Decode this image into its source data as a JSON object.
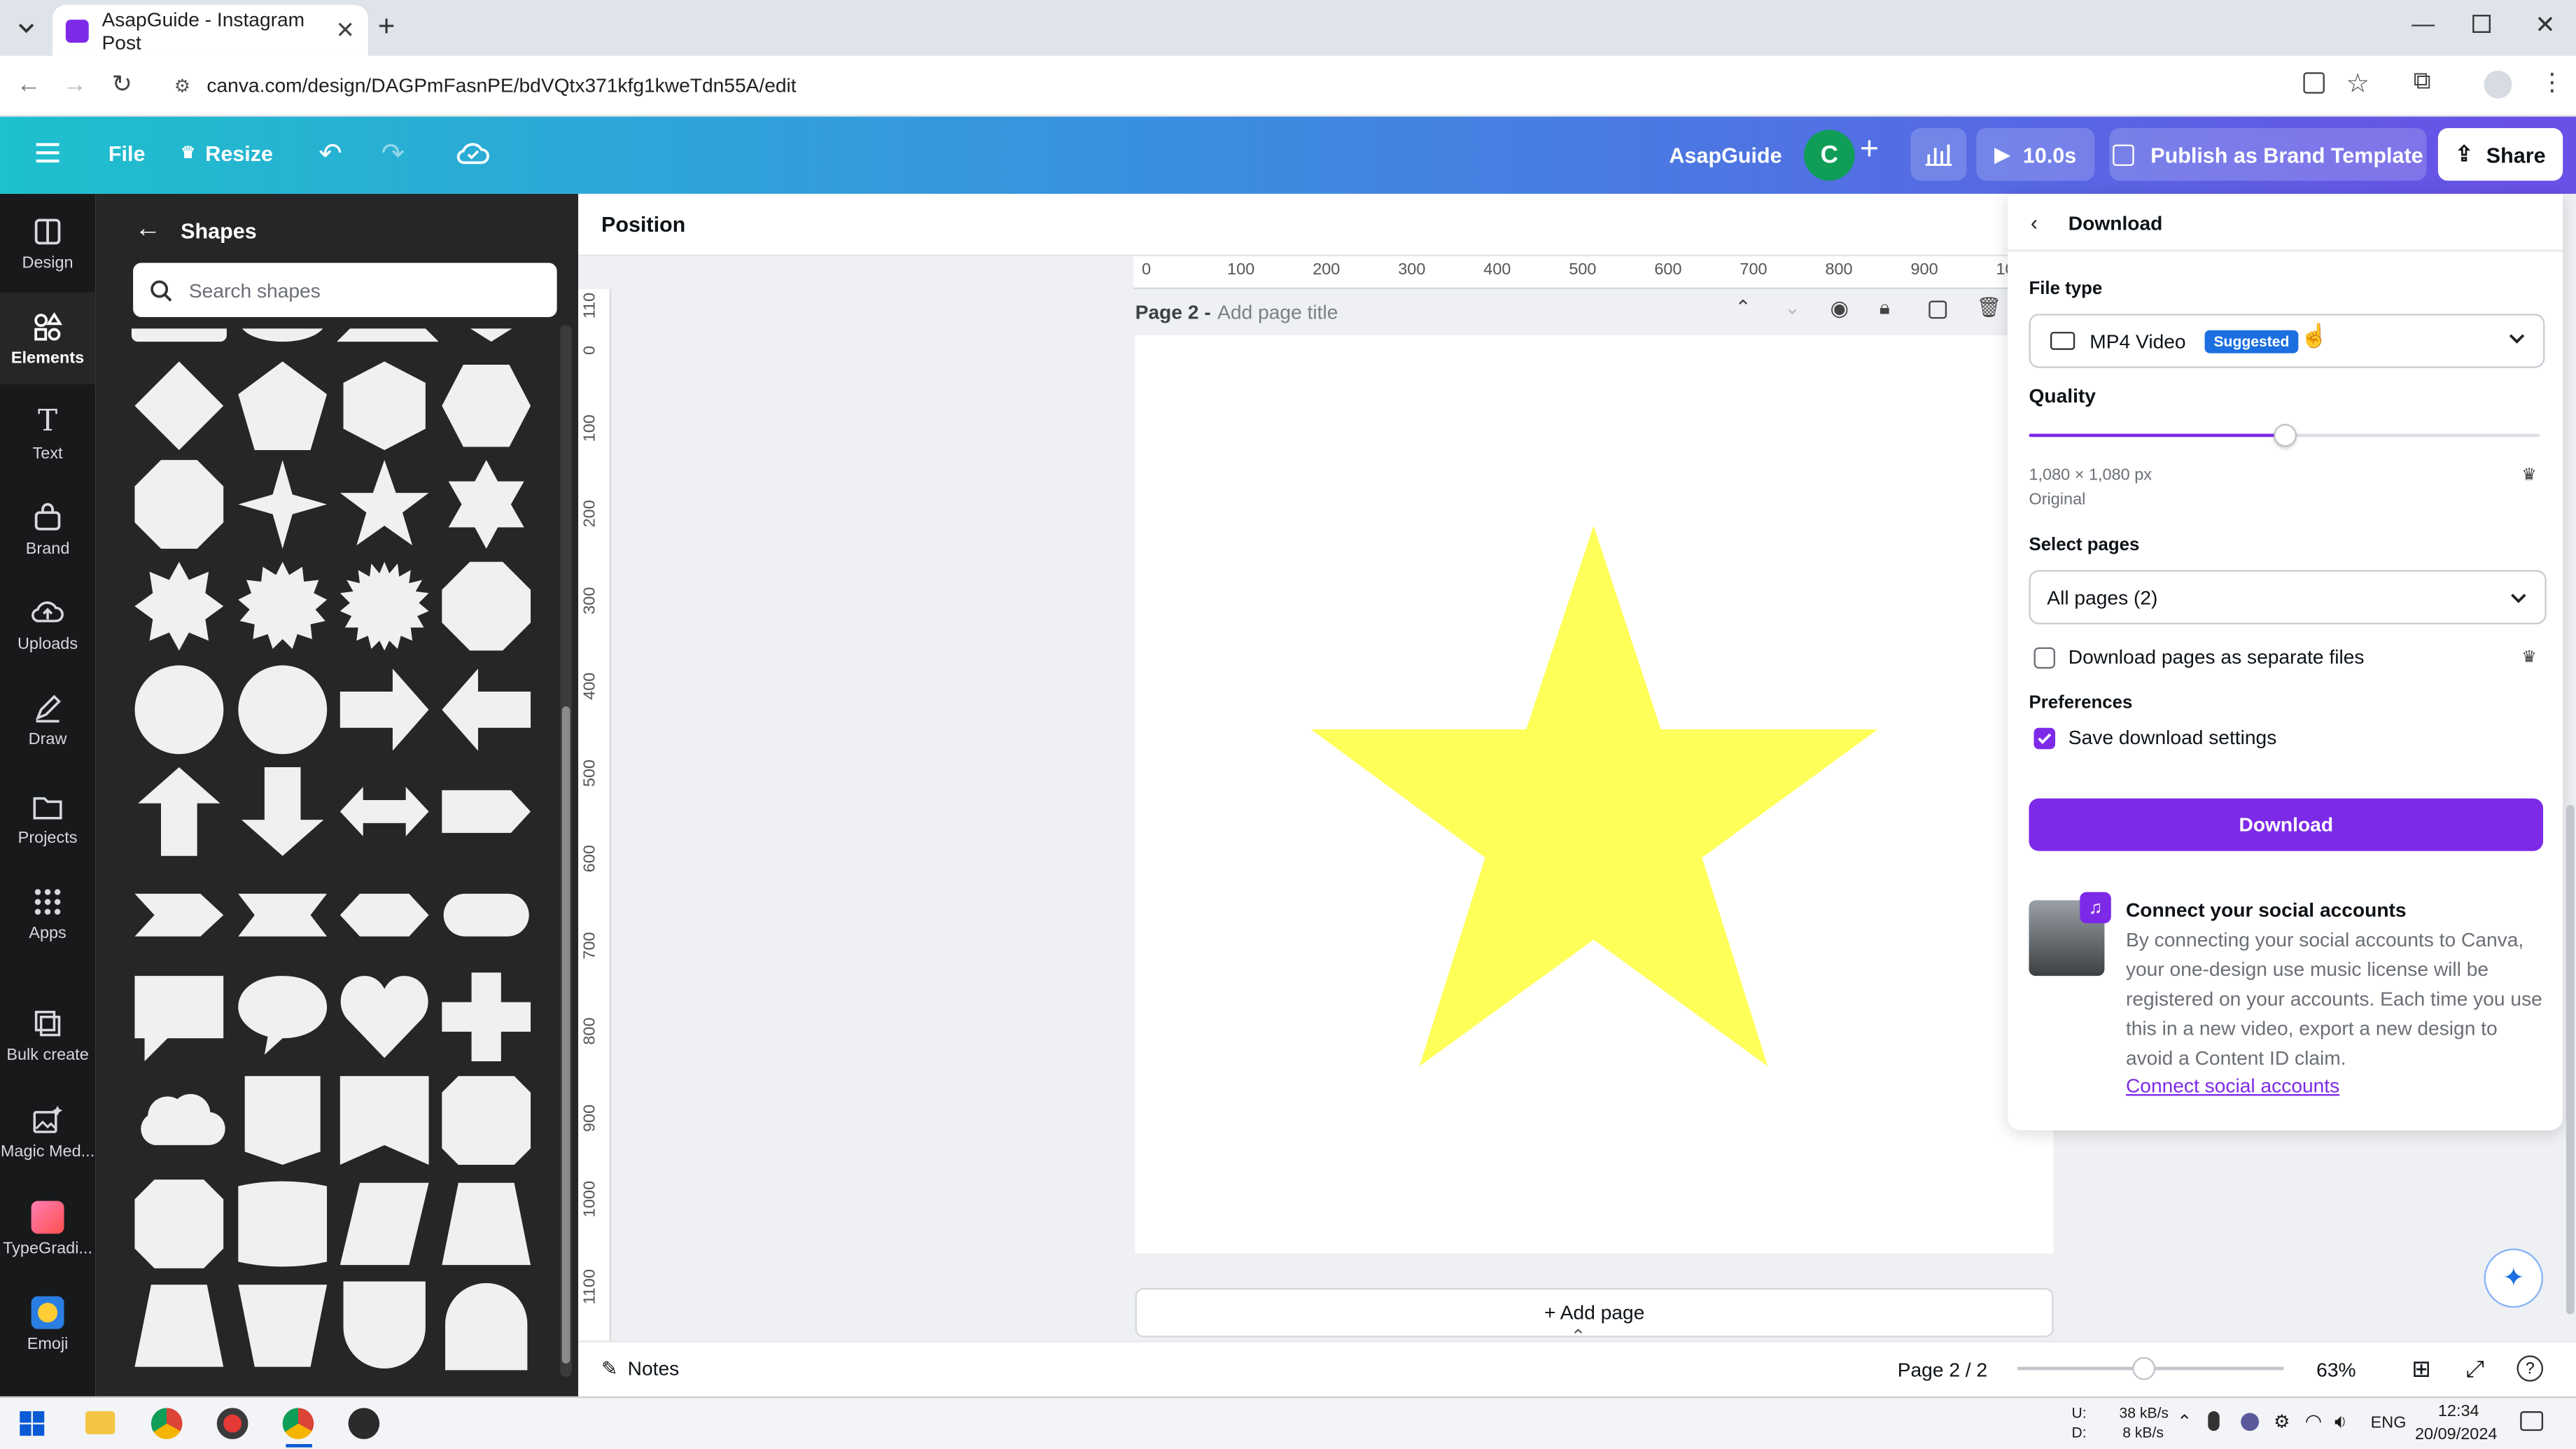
{
  "browser": {
    "tab_title": "AsapGuide - Instagram Post",
    "url": "canva.com/design/DAGPmFasnPE/bdVQtx371kfg1kweTdn55A/edit"
  },
  "header": {
    "file": "File",
    "resize": "Resize",
    "brand_name": "AsapGuide",
    "avatar_letter": "C",
    "play_time": "10.0s",
    "publish": "Publish as Brand Template",
    "share": "Share"
  },
  "rail": [
    {
      "label": "Design",
      "icon": "design-icon"
    },
    {
      "label": "Elements",
      "icon": "elements-icon"
    },
    {
      "label": "Text",
      "icon": "text-icon"
    },
    {
      "label": "Brand",
      "icon": "brand-icon"
    },
    {
      "label": "Uploads",
      "icon": "uploads-icon"
    },
    {
      "label": "Draw",
      "icon": "draw-icon"
    },
    {
      "label": "Projects",
      "icon": "projects-icon"
    },
    {
      "label": "Apps",
      "icon": "apps-icon"
    },
    {
      "label": "Bulk create",
      "icon": "bulk-create-icon"
    },
    {
      "label": "Magic Med...",
      "icon": "magic-media-icon"
    },
    {
      "label": "TypeGradi...",
      "icon": "typegradient-icon"
    },
    {
      "label": "Emoji",
      "icon": "emoji-icon"
    }
  ],
  "shapes_panel": {
    "title": "Shapes",
    "search_placeholder": "Search shapes"
  },
  "editor": {
    "position": "Position",
    "page_label": "Page 2 -",
    "page_title_placeholder": "Add page title",
    "add_page": "+ Add page",
    "ruler_top": [
      "0",
      "100",
      "200",
      "300",
      "400",
      "500",
      "600",
      "700",
      "800",
      "900",
      "10"
    ],
    "ruler_left": [
      "110",
      "0",
      "100",
      "200",
      "300",
      "400",
      "500",
      "600",
      "700",
      "800",
      "900",
      "1000",
      "1100"
    ],
    "star_color": "#ffff5a"
  },
  "download": {
    "title": "Download",
    "file_type_label": "File type",
    "file_type_value": "MP4 Video",
    "suggested_badge": "Suggested",
    "quality_label": "Quality",
    "quality_fraction": 0.5,
    "resolution": "1,080 × 1,080 px",
    "resolution_sub": "Original",
    "select_pages_label": "Select pages",
    "select_pages_value": "All pages (2)",
    "separate_files": "Download pages as separate files",
    "preferences_label": "Preferences",
    "save_settings": "Save download settings",
    "download_button": "Download",
    "social_title": "Connect your social accounts",
    "social_body": "By connecting your social accounts to Canva, your one-design use music license will be registered on your accounts. Each time you use this in a new video, export a new design to avoid a Content ID claim.",
    "social_link": "Connect social accounts",
    "accent": "#7d2ae8"
  },
  "status": {
    "notes": "Notes",
    "page_indicator": "Page 2 / 2",
    "zoom": "63%"
  },
  "taskbar": {
    "net_up_label": "U:",
    "net_down_label": "D:",
    "net_up": "38 kB/s",
    "net_down": "8 kB/s",
    "lang": "ENG",
    "time": "12:34",
    "date": "20/09/2024"
  }
}
